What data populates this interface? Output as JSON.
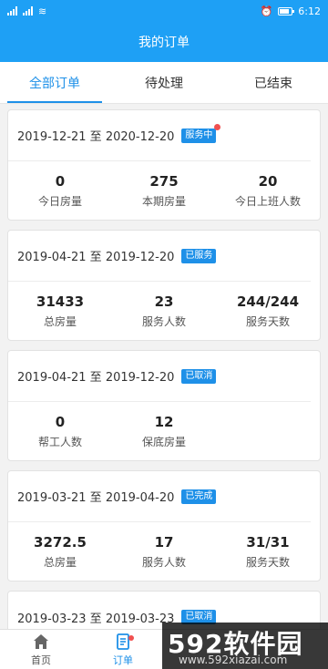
{
  "status": {
    "time": "6:12",
    "carrier_icons": "signal-icons"
  },
  "header": {
    "title": "我的订单"
  },
  "tabs": [
    {
      "label": "全部订单",
      "active": true
    },
    {
      "label": "待处理",
      "active": false
    },
    {
      "label": "已结束",
      "active": false
    }
  ],
  "orders": [
    {
      "date": "2019-12-21 至 2020-12-20",
      "badge": "服务中",
      "badge_dot": true,
      "stats": [
        {
          "value": "0",
          "label": "今日房量"
        },
        {
          "value": "275",
          "label": "本期房量"
        },
        {
          "value": "20",
          "label": "今日上班人数"
        }
      ]
    },
    {
      "date": "2019-04-21 至 2019-12-20",
      "badge": "已服务",
      "stats": [
        {
          "value": "31433",
          "label": "总房量"
        },
        {
          "value": "23",
          "label": "服务人数"
        },
        {
          "value": "244/244",
          "label": "服务天数"
        }
      ]
    },
    {
      "date": "2019-04-21 至 2019-12-20",
      "badge": "已取消",
      "stats": [
        {
          "value": "0",
          "label": "帮工人数"
        },
        {
          "value": "12",
          "label": "保底房量"
        }
      ]
    },
    {
      "date": "2019-03-21 至 2019-04-20",
      "badge": "已完成",
      "stats": [
        {
          "value": "3272.5",
          "label": "总房量"
        },
        {
          "value": "17",
          "label": "服务人数"
        },
        {
          "value": "31/31",
          "label": "服务天数"
        }
      ]
    },
    {
      "date": "2019-03-23 至 2019-03-23",
      "badge": "已取消",
      "stats": []
    }
  ],
  "bottom_nav": [
    {
      "label": "首页",
      "icon": "home-icon"
    },
    {
      "label": "订单",
      "icon": "order-icon",
      "active": true,
      "dot": true
    }
  ],
  "watermark": {
    "brand": "592软件园",
    "url": "www.592xiazai.com"
  },
  "colors": {
    "primary": "#1ea0f5",
    "accent": "#1e90e8",
    "dot": "#f05050"
  }
}
